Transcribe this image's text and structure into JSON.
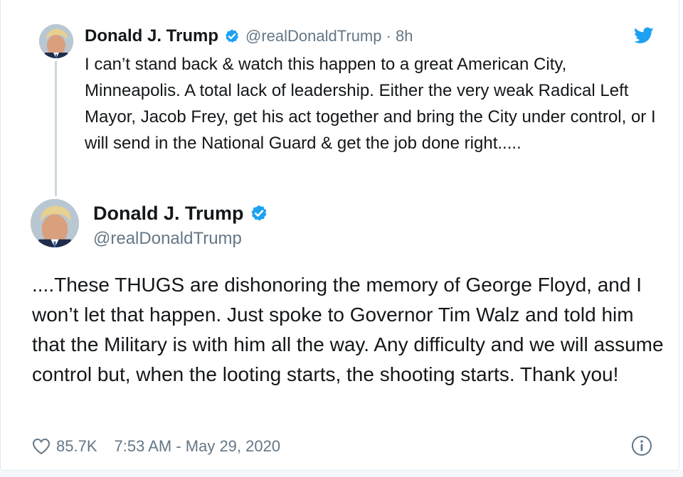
{
  "parent_tweet": {
    "name": "Donald J. Trump",
    "handle_time": "@realDonaldTrump · 8h",
    "text": "I can’t stand back & watch this happen to a great American City, Minneapolis. A total lack of leadership. Either the very weak Radical Left Mayor, Jacob Frey, get his act together and bring the City under control, or I will send in the National Guard & get the job done right....."
  },
  "main_tweet": {
    "name": "Donald J. Trump",
    "handle": "@realDonaldTrump",
    "text": "....These THUGS are dishonoring the memory of George Floyd, and I won’t let that happen. Just spoke to Governor Tim Walz and told him that the Military is with him all the way. Any difficulty and we will assume control but, when the looting starts, the shooting starts. Thank you!",
    "likes": "85.7K",
    "timestamp": "7:53 AM - May 29, 2020"
  },
  "icons": {
    "verified": "verified-badge-icon",
    "brand": "twitter-bird-icon",
    "like": "heart-icon",
    "info": "info-icon"
  },
  "colors": {
    "verified_blue": "#1da1f2",
    "muted_text": "#657786",
    "thread_line": "#ccd6dd",
    "border": "#e1e8ed"
  }
}
